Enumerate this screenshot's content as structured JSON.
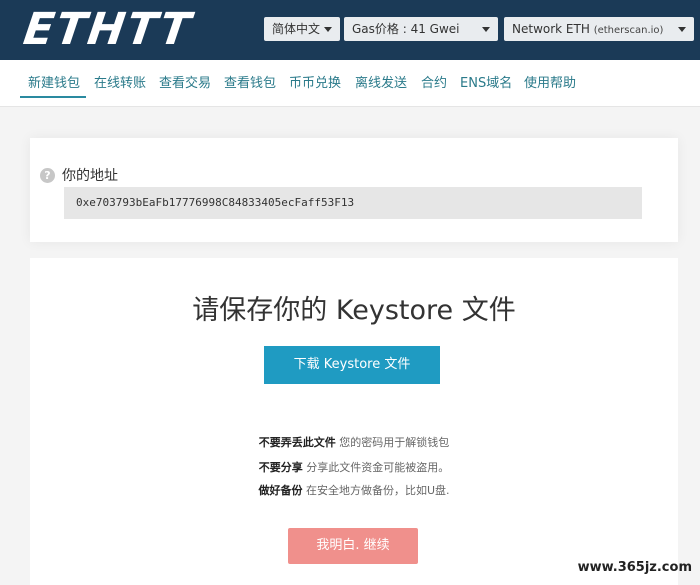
{
  "header": {
    "logo": "ETHTT",
    "language": "简体中文",
    "gas": "Gas价格 : 41 Gwei",
    "network_main": "Network ETH",
    "network_sub": "(etherscan.io)"
  },
  "nav": {
    "items": [
      "新建钱包",
      "在线转账",
      "查看交易",
      "查看钱包",
      "币币兑换",
      "离线发送",
      "合约",
      "ENS域名",
      "使用帮助"
    ]
  },
  "address_card": {
    "label": "你的地址",
    "address": "0xe703793bEaFb17776998C84833405ecFaff53F13"
  },
  "main": {
    "title": "请保存你的 Keystore 文件",
    "download_label": "下载 Keystore 文件",
    "warnings": [
      {
        "strong": "不要弄丢此文件",
        "text": " 您的密码用于解锁钱包"
      },
      {
        "strong": "不要分享",
        "text": " 分享此文件资金可能被盗用。"
      },
      {
        "strong": "做好备份",
        "text": " 在安全地方做备份，比如U盘."
      }
    ],
    "continue_label": "我明白. 继续"
  },
  "watermark": "www.365jz.com"
}
